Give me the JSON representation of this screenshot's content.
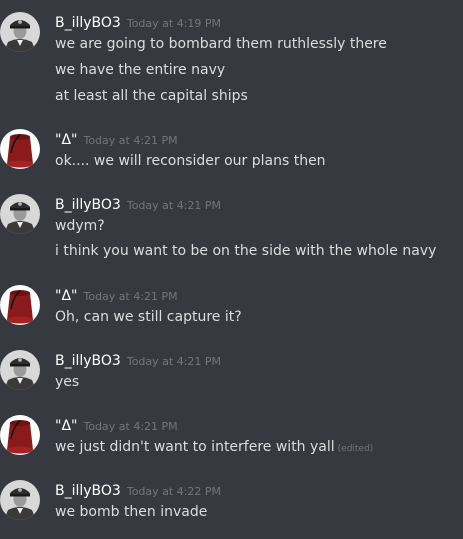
{
  "theme": {
    "background": "#36393f",
    "username_color": "#ffffff",
    "text_color": "#dcddde",
    "timestamp_color": "#72767d",
    "fez_color": "#8b1a1a"
  },
  "messages": [
    {
      "author": "B_illyBO3",
      "avatar_icon": "officer-portrait",
      "timestamp": "Today at 4:19 PM",
      "lines": [
        "we are going to bombard them ruthlessly there",
        "we have the entire navy",
        "at least all the capital ships"
      ]
    },
    {
      "author": "\"Δ\"",
      "avatar_icon": "red-fez",
      "timestamp": "Today at 4:21 PM",
      "lines": [
        "ok.... we will reconsider our plans then"
      ]
    },
    {
      "author": "B_illyBO3",
      "avatar_icon": "officer-portrait",
      "timestamp": "Today at 4:21 PM",
      "lines": [
        "wdym?",
        "i think you want to be on the side with the whole navy"
      ]
    },
    {
      "author": "\"Δ\"",
      "avatar_icon": "red-fez",
      "timestamp": "Today at 4:21 PM",
      "lines": [
        "Oh, can we still capture it?"
      ]
    },
    {
      "author": "B_illyBO3",
      "avatar_icon": "officer-portrait",
      "timestamp": "Today at 4:21 PM",
      "lines": [
        "yes"
      ]
    },
    {
      "author": "\"Δ\"",
      "avatar_icon": "red-fez",
      "timestamp": "Today at 4:21 PM",
      "lines": [
        "we just didn't want to interfere with yall"
      ],
      "edited_label": "(edited)"
    },
    {
      "author": "B_illyBO3",
      "avatar_icon": "officer-portrait",
      "timestamp": "Today at 4:22 PM",
      "lines": [
        "we bomb then invade"
      ]
    }
  ]
}
